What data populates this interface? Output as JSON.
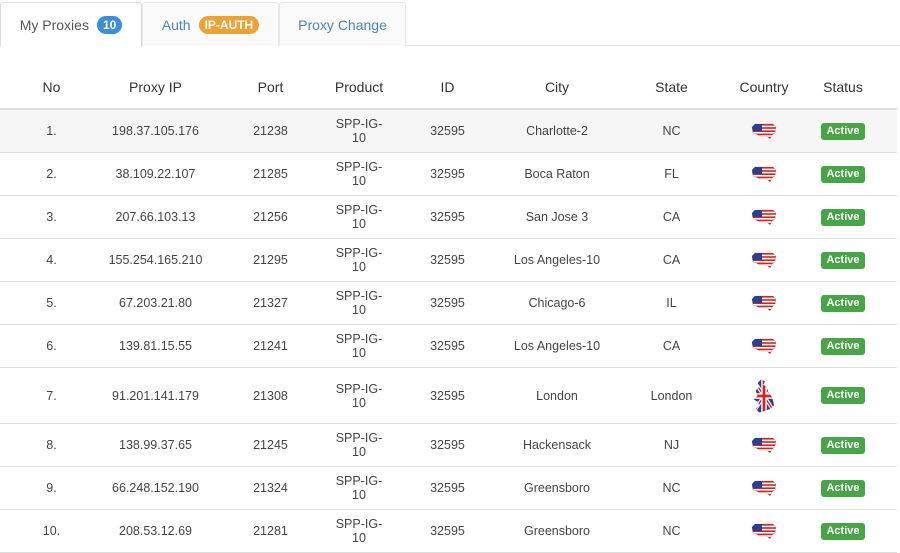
{
  "tabs": [
    {
      "label": "My Proxies",
      "badge": "10"
    },
    {
      "label": "Auth",
      "badge": "IP-AUTH"
    },
    {
      "label": "Proxy Change"
    }
  ],
  "table": {
    "headers": [
      "No",
      "Proxy IP",
      "Port",
      "Product",
      "ID",
      "City",
      "State",
      "Country",
      "Status"
    ],
    "rows": [
      {
        "no": "1.",
        "ip": "198.37.105.176",
        "port": "21238",
        "product": "SPP-IG-10",
        "id": "32595",
        "city": "Charlotte-2",
        "state": "NC",
        "country": "us-flag-icon",
        "status": "Active"
      },
      {
        "no": "2.",
        "ip": "38.109.22.107",
        "port": "21285",
        "product": "SPP-IG-10",
        "id": "32595",
        "city": "Boca Raton",
        "state": "FL",
        "country": "us-flag-icon",
        "status": "Active"
      },
      {
        "no": "3.",
        "ip": "207.66.103.13",
        "port": "21256",
        "product": "SPP-IG-10",
        "id": "32595",
        "city": "San Jose 3",
        "state": "CA",
        "country": "us-flag-icon",
        "status": "Active"
      },
      {
        "no": "4.",
        "ip": "155.254.165.210",
        "port": "21295",
        "product": "SPP-IG-10",
        "id": "32595",
        "city": "Los Angeles-10",
        "state": "CA",
        "country": "us-flag-icon",
        "status": "Active"
      },
      {
        "no": "5.",
        "ip": "67.203.21.80",
        "port": "21327",
        "product": "SPP-IG-10",
        "id": "32595",
        "city": "Chicago-6",
        "state": "IL",
        "country": "us-flag-icon",
        "status": "Active"
      },
      {
        "no": "6.",
        "ip": "139.81.15.55",
        "port": "21241",
        "product": "SPP-IG-10",
        "id": "32595",
        "city": "Los Angeles-10",
        "state": "CA",
        "country": "us-flag-icon",
        "status": "Active"
      },
      {
        "no": "7.",
        "ip": "91.201.141.179",
        "port": "21308",
        "product": "SPP-IG-10",
        "id": "32595",
        "city": "London",
        "state": "London",
        "country": "uk-flag-icon",
        "status": "Active"
      },
      {
        "no": "8.",
        "ip": "138.99.37.65",
        "port": "21245",
        "product": "SPP-IG-10",
        "id": "32595",
        "city": "Hackensack",
        "state": "NJ",
        "country": "us-flag-icon",
        "status": "Active"
      },
      {
        "no": "9.",
        "ip": "66.248.152.190",
        "port": "21324",
        "product": "SPP-IG-10",
        "id": "32595",
        "city": "Greensboro",
        "state": "NC",
        "country": "us-flag-icon",
        "status": "Active"
      },
      {
        "no": "10.",
        "ip": "208.53.12.69",
        "port": "21281",
        "product": "SPP-IG-10",
        "id": "32595",
        "city": "Greensboro",
        "state": "NC",
        "country": "us-flag-icon",
        "status": "Active"
      }
    ]
  }
}
